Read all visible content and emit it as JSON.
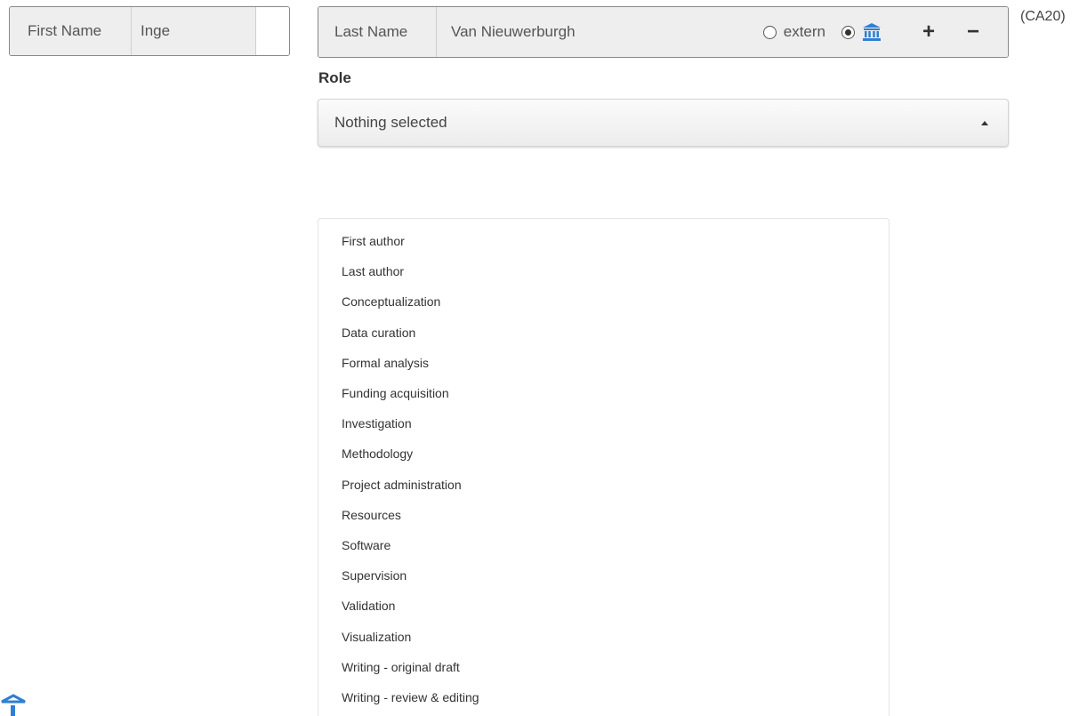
{
  "first_name": {
    "label": "First Name",
    "value": "Inge"
  },
  "last_name": {
    "label": "Last Name",
    "value": "Van Nieuwerburgh",
    "radio_extern_label": "extern",
    "radio_extern_checked": false,
    "radio_internal_checked": true,
    "internal_icon": "institution-icon",
    "add_label": "+",
    "remove_label": "−"
  },
  "code_tag": "(CA20)",
  "role": {
    "label": "Role",
    "placeholder": "Nothing selected",
    "options": [
      "First author",
      "Last author",
      "Conceptualization",
      "Data curation",
      "Formal analysis",
      "Funding acquisition",
      "Investigation",
      "Methodology",
      "Project administration",
      "Resources",
      "Software",
      "Supervision",
      "Validation",
      "Visualization",
      "Writing - original draft",
      "Writing - review & editing"
    ]
  },
  "colors": {
    "institution_icon": "#2f7fd3",
    "addon_bg": "#eeeeee",
    "border": "#888888"
  }
}
